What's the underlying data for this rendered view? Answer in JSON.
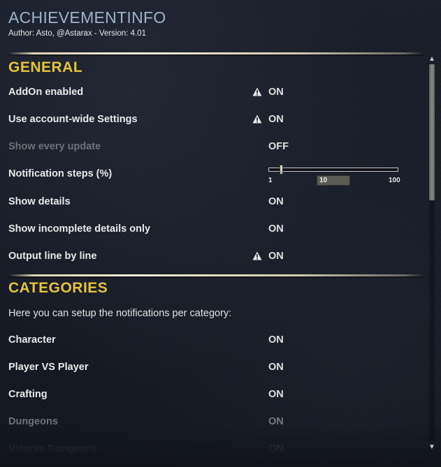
{
  "addon": {
    "title": "ACHIEVEMENTINFO",
    "author_line": "Author: Asto, @Astarax - Version: 4.01"
  },
  "sections": {
    "general": {
      "header": "GENERAL",
      "rows": {
        "addon_enabled": {
          "label": "AddOn enabled",
          "value": "ON",
          "warning": true
        },
        "account_wide": {
          "label": "Use account-wide Settings",
          "value": "ON",
          "warning": true
        },
        "show_every_update": {
          "label": "Show every update",
          "value": "OFF",
          "disabled": true
        },
        "notification_steps": {
          "label": "Notification steps (%)",
          "slider": {
            "min_label": "1",
            "max_label": "100",
            "value_label": "10",
            "value": 10,
            "min": 1,
            "max": 100
          }
        },
        "show_details": {
          "label": "Show details",
          "value": "ON"
        },
        "show_incomplete_details_only": {
          "label": "Show incomplete details only",
          "value": "ON"
        },
        "output_line_by_line": {
          "label": "Output line by line",
          "value": "ON",
          "warning": true
        }
      }
    },
    "categories": {
      "header": "CATEGORIES",
      "description": "Here you can setup the notifications per category:",
      "rows": {
        "character": {
          "label": "Character",
          "value": "ON"
        },
        "player_vs_player": {
          "label": "Player VS Player",
          "value": "ON"
        },
        "crafting": {
          "label": "Crafting",
          "value": "ON"
        },
        "dungeons": {
          "label": "Dungeons",
          "value": "ON",
          "disabled": true
        },
        "veteran_dungeons": {
          "label": "Veteran Dungeons",
          "value": "ON",
          "faded": true
        }
      }
    }
  },
  "icons": {
    "warning": "warning-icon",
    "scroll_up": "scroll-up-arrow-icon",
    "scroll_down": "scroll-down-arrow-icon"
  },
  "colors": {
    "title": "#9fb4c9",
    "section_header": "#e5c33e",
    "label": "#e9e9e9",
    "disabled": "#6e7178",
    "background": "#141821"
  },
  "scrollbar": {
    "position": 0,
    "visible_fraction": 0.36
  }
}
